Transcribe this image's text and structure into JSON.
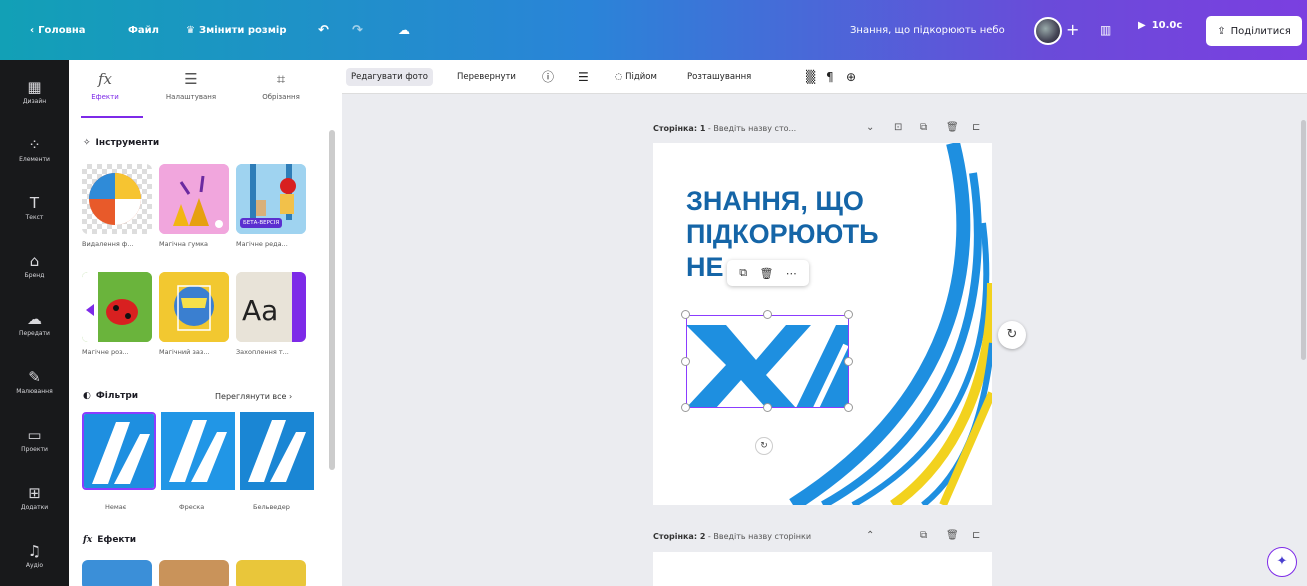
{
  "topbar": {
    "back": "Головна",
    "file": "Файл",
    "resize": "Змінити розмір",
    "design_title": "Знання, що підкорюють небо",
    "timer": "10.0с",
    "share": "Поділитися"
  },
  "rail": [
    {
      "label": "Дизайн",
      "icon": "layout-icon"
    },
    {
      "label": "Елементи",
      "icon": "elements-icon"
    },
    {
      "label": "Текст",
      "icon": "text-icon"
    },
    {
      "label": "Бренд",
      "icon": "brand-icon"
    },
    {
      "label": "Передати",
      "icon": "upload-icon"
    },
    {
      "label": "Малювання",
      "icon": "draw-icon"
    },
    {
      "label": "Проекти",
      "icon": "folder-icon"
    },
    {
      "label": "Додатки",
      "icon": "apps-icon"
    },
    {
      "label": "Аудіо",
      "icon": "audio-icon"
    }
  ],
  "panel": {
    "tabs": [
      "Ефекти",
      "Налаштуваня",
      "Обрізання"
    ],
    "tools_title": "Інструменти",
    "tools": [
      "Видалення ф...",
      "Магічна гумка",
      "Магічне реда...",
      "Магічне роз...",
      "Магічний заз...",
      "Захоплення т..."
    ],
    "beta_badge": "БЕТА-ВЕРСІЯ",
    "filters_title": "Фільтри",
    "see_all": "Переглянути все",
    "filters": [
      "Немає",
      "Фреска",
      "Бельведер"
    ],
    "effects_title": "Ефекти"
  },
  "toolbar": {
    "edit_photo": "Редагувати фото",
    "flip": "Перевернути",
    "animate": "Підйом",
    "position": "Розташування"
  },
  "canvas": {
    "page1_label": "Сторінка: 1",
    "page1_placeholder": "Введіть назву сто...",
    "page2_label": "Сторінка: 2",
    "page2_placeholder": "Введіть назву сторінки",
    "headline": [
      "ЗНАННЯ, ЩО",
      "ПІДКОРЮЮТЬ",
      "НЕ"
    ]
  },
  "colors": {
    "accent": "#7d2ae8",
    "headline": "#1565a7",
    "brand_blue": "#1e8fe0",
    "brand_yellow": "#f2d21e"
  }
}
